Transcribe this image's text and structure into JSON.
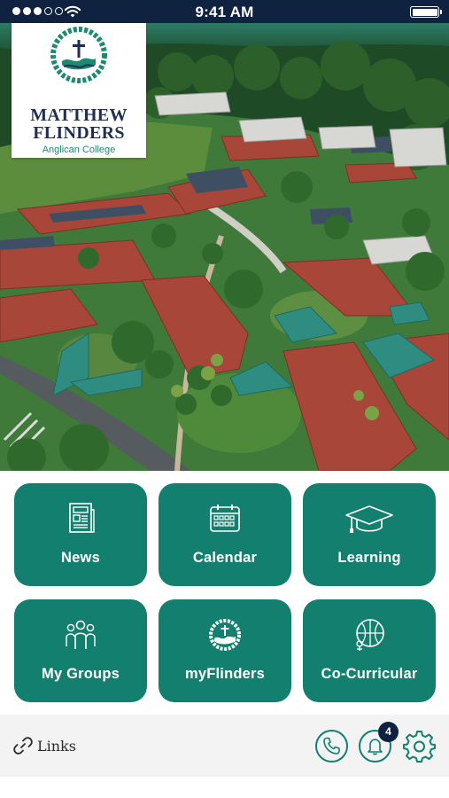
{
  "status_bar": {
    "time": "9:41 AM",
    "signal_bars_filled": 3,
    "signal_bars_total": 5,
    "wifi_icon": "wifi-icon",
    "battery_icon": "battery-full-icon",
    "background": "#0f2340"
  },
  "logo": {
    "name_line1": "MATTHEW",
    "name_line2": "FLINDERS",
    "subtitle": "Anglican College",
    "crest_icon": "college-crest-icon",
    "text_color": "#1f2e54",
    "accent_color": "#1d8a72"
  },
  "hero": {
    "image": "campus-aerial-photo"
  },
  "tiles": [
    {
      "label": "News",
      "icon": "newspaper-icon"
    },
    {
      "label": "Calendar",
      "icon": "calendar-icon"
    },
    {
      "label": "Learning",
      "icon": "graduation-cap-icon"
    },
    {
      "label": "My Groups",
      "icon": "group-icon"
    },
    {
      "label": "myFlinders",
      "icon": "college-crest-icon"
    },
    {
      "label": "Co-Curricular",
      "icon": "sports-ball-icon"
    }
  ],
  "bottom_bar": {
    "links_label": "Links",
    "links_icon": "link-icon",
    "phone_icon": "phone-icon",
    "notifications_icon": "bell-icon",
    "notification_count": "4",
    "settings_icon": "gear-icon"
  },
  "colors": {
    "tile": "#137f6f",
    "badge": "#0f2340",
    "bottom_bar": "#f3f3f3"
  }
}
